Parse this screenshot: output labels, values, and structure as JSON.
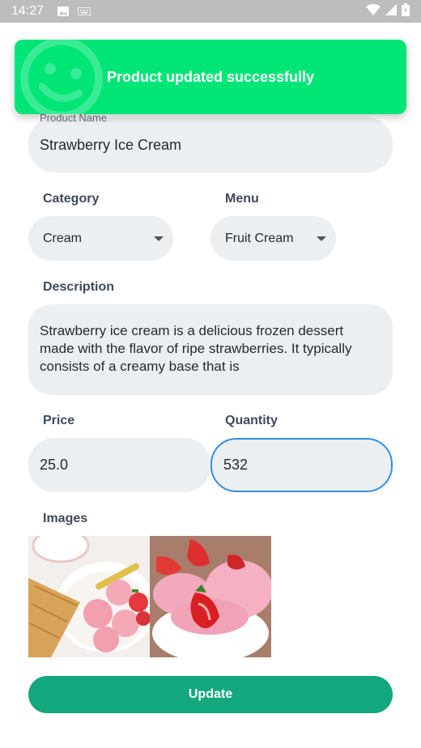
{
  "status_bar": {
    "time": "14:27"
  },
  "toast": {
    "message": "Product updated successfully"
  },
  "form": {
    "product_name_label": "Product Name",
    "product_name_value": "Strawberry Ice Cream",
    "category_label": "Category",
    "category_value": "Cream",
    "menu_label": "Menu",
    "menu_value": "Fruit Cream",
    "description_label": "Description",
    "description_value": "Strawberry ice cream is a delicious frozen dessert made with the flavor of ripe strawberries. It typically consists of a creamy base that is",
    "price_label": "Price",
    "price_value": "25.0",
    "quantity_label": "Quantity",
    "quantity_value": "532",
    "images_label": "Images",
    "update_label": "Update"
  },
  "colors": {
    "toast_bg": "#00e676",
    "update_button": "#13a77d",
    "field_bg": "#eceff1",
    "focus_border": "#2f8fe3"
  }
}
